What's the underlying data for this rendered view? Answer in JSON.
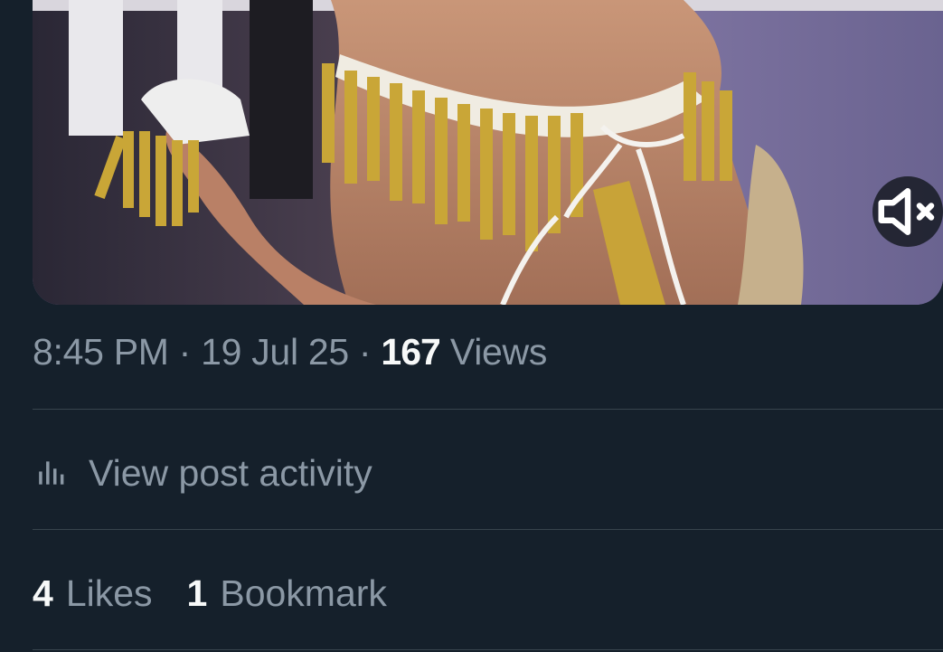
{
  "media": {
    "type": "video",
    "mute_icon": "speaker-muted-icon"
  },
  "meta": {
    "time": "8:45 PM",
    "sep1": " · ",
    "date": "19 Jul 25",
    "sep2": " · ",
    "views_count": "167",
    "views_label": " Views"
  },
  "activity": {
    "icon": "analytics-bars-icon",
    "label": "View post activity"
  },
  "stats": [
    {
      "count": "4",
      "label": "Likes"
    },
    {
      "count": "1",
      "label": "Bookmark"
    }
  ],
  "colors": {
    "background": "#15202b",
    "secondary_text": "#8b98a5",
    "primary_text": "#f7f9f9",
    "divider": "#38444d"
  }
}
